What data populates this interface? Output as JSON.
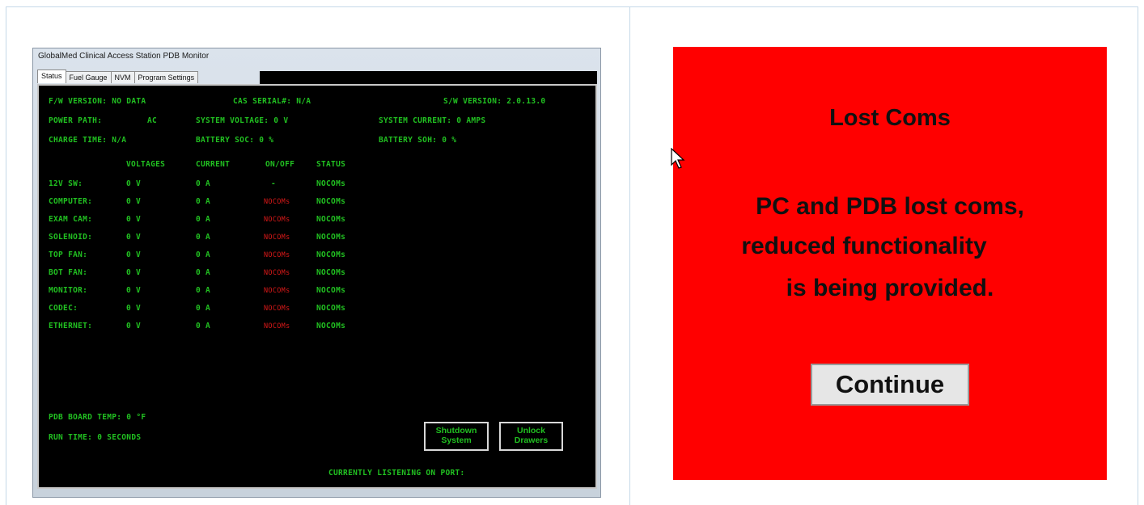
{
  "window": {
    "title": "GlobalMed Clinical Access Station PDB Monitor",
    "tabs": [
      "Status",
      "Fuel Gauge",
      "NVM",
      "Program Settings"
    ]
  },
  "status": {
    "fw_version": "F/W VERSION:  NO DATA",
    "cas_serial": "CAS SERIAL#:  N/A",
    "sw_version": "S/W VERSION:  2.0.13.0",
    "power_path_label": "POWER PATH:",
    "power_path_value": "AC",
    "system_voltage": "SYSTEM VOLTAGE: 0 V",
    "system_current": "SYSTEM CURRENT: 0 AMPS",
    "charge_time": "CHARGE TIME: N/A",
    "battery_soc": "BATTERY SOC: 0 %",
    "battery_soh": "BATTERY SOH: 0 %"
  },
  "table": {
    "headers": [
      "VOLTAGES",
      "CURRENT",
      "ON/OFF",
      "STATUS"
    ],
    "rows": [
      {
        "name": "12V SW:",
        "voltage": "0 V",
        "current": "0 A",
        "onoff": "-",
        "status": "NOCOMs"
      },
      {
        "name": "COMPUTER:",
        "voltage": "0 V",
        "current": "0 A",
        "onoff": "NOCOMs",
        "status": "NOCOMs"
      },
      {
        "name": "EXAM CAM:",
        "voltage": "0 V",
        "current": "0 A",
        "onoff": "NOCOMs",
        "status": "NOCOMs"
      },
      {
        "name": "SOLENOID:",
        "voltage": "0 V",
        "current": "0 A",
        "onoff": "NOCOMs",
        "status": "NOCOMs"
      },
      {
        "name": "TOP FAN:",
        "voltage": "0 V",
        "current": "0 A",
        "onoff": "NOCOMs",
        "status": "NOCOMs"
      },
      {
        "name": "BOT FAN:",
        "voltage": "0 V",
        "current": "0 A",
        "onoff": "NOCOMs",
        "status": "NOCOMs"
      },
      {
        "name": "MONITOR:",
        "voltage": "0 V",
        "current": "0 A",
        "onoff": "NOCOMs",
        "status": "NOCOMs"
      },
      {
        "name": "CODEC:",
        "voltage": "0 V",
        "current": "0 A",
        "onoff": "NOCOMs",
        "status": "NOCOMs"
      },
      {
        "name": "ETHERNET:",
        "voltage": "0 V",
        "current": "0 A",
        "onoff": "NOCOMs",
        "status": "NOCOMs"
      }
    ]
  },
  "footer": {
    "board_temp": "PDB BOARD TEMP: 0 °F",
    "run_time": "RUN TIME: 0 SECONDS",
    "listening": "CURRENTLY LISTENING ON PORT:",
    "shutdown_line1": "Shutdown",
    "shutdown_line2": "System",
    "unlock_line1": "Unlock",
    "unlock_line2": "Drawers"
  },
  "dialog": {
    "title": "Lost Coms",
    "line1": "PC and PDB lost coms,",
    "line2": "reduced functionality",
    "line3": "is being provided.",
    "button": "Continue"
  },
  "colors": {
    "terminal_green": "#21c021",
    "nocoms_red": "#d81818",
    "dialog_red": "#ff0000"
  }
}
